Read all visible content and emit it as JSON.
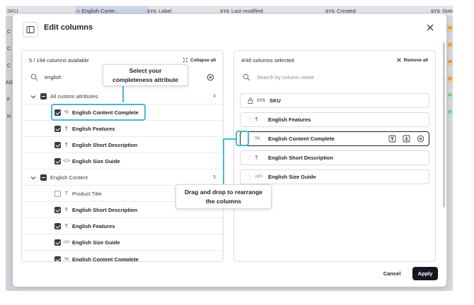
{
  "background_table": {
    "columns": [
      {
        "prefix": "",
        "label": "SKU"
      },
      {
        "prefix": "",
        "label": "English Conte..."
      },
      {
        "prefix": "SYS",
        "label": "Label"
      },
      {
        "prefix": "SYS",
        "label": "Last modified"
      },
      {
        "prefix": "SYS",
        "label": "Created"
      },
      {
        "prefix": "SYS",
        "label": "Statu"
      }
    ],
    "left_letters": [
      "C",
      "C",
      "C",
      "AG",
      "F",
      "N"
    ],
    "status_tags": [
      "aft",
      "aft",
      "aft",
      "aft",
      "m",
      "m"
    ]
  },
  "modal": {
    "title": "Edit columns",
    "left": {
      "count_text": "5 / 194 columns available",
      "collapse_label": "Collapse all",
      "search_value": "english",
      "groups": [
        {
          "label": "All custom attributes",
          "count": "4",
          "items": [
            {
              "label": "English Content Complete",
              "icon": "percent-icon",
              "glyph": "%",
              "checked": true,
              "bold": true
            },
            {
              "label": "English Features",
              "icon": "paragraph-icon",
              "glyph": "¶",
              "checked": true,
              "bold": true
            },
            {
              "label": "English Short Description",
              "icon": "paragraph-icon",
              "glyph": "¶",
              "checked": true,
              "bold": true
            },
            {
              "label": "English Size Guide",
              "icon": "code-icon",
              "glyph": "</>",
              "checked": true,
              "bold": true
            }
          ]
        },
        {
          "label": "English Content",
          "count": "5",
          "items": [
            {
              "label": "Product Title",
              "icon": "text-icon",
              "glyph": "T",
              "checked": false,
              "bold": false
            },
            {
              "label": "English Short Description",
              "icon": "paragraph-icon",
              "glyph": "¶",
              "checked": true,
              "bold": true
            },
            {
              "label": "English Features",
              "icon": "paragraph-icon",
              "glyph": "¶",
              "checked": true,
              "bold": true
            },
            {
              "label": "English Size Guide",
              "icon": "code-icon",
              "glyph": "</>",
              "checked": true,
              "bold": true
            },
            {
              "label": "English Content Complete",
              "icon": "percent-icon",
              "glyph": "%",
              "checked": true,
              "bold": true
            }
          ]
        }
      ]
    },
    "right": {
      "count_text": "4/40 columns selected",
      "remove_label": "Remove all",
      "search_placeholder": "Search by column name",
      "items": [
        {
          "label": "SKU",
          "sys": "SYS",
          "locked": true
        },
        {
          "label": "English Features",
          "glyph": "¶",
          "icon": "paragraph-icon"
        },
        {
          "label": "English Content Complete",
          "glyph": "%",
          "icon": "percent-icon",
          "active": true
        },
        {
          "label": "English Short Description",
          "glyph": "¶",
          "icon": "paragraph-icon"
        },
        {
          "label": "English Size Guide",
          "glyph": "</>",
          "icon": "code-icon"
        }
      ]
    },
    "buttons": {
      "cancel": "Cancel",
      "apply": "Apply"
    }
  },
  "tooltips": {
    "select": [
      "Select your",
      "completeness attribute"
    ],
    "drag": [
      "Drag and drop to rearrange",
      "the columns"
    ]
  },
  "colors": {
    "accent": "#49b6d3",
    "primary": "#16161f",
    "backdrop": "#d9d9de"
  }
}
